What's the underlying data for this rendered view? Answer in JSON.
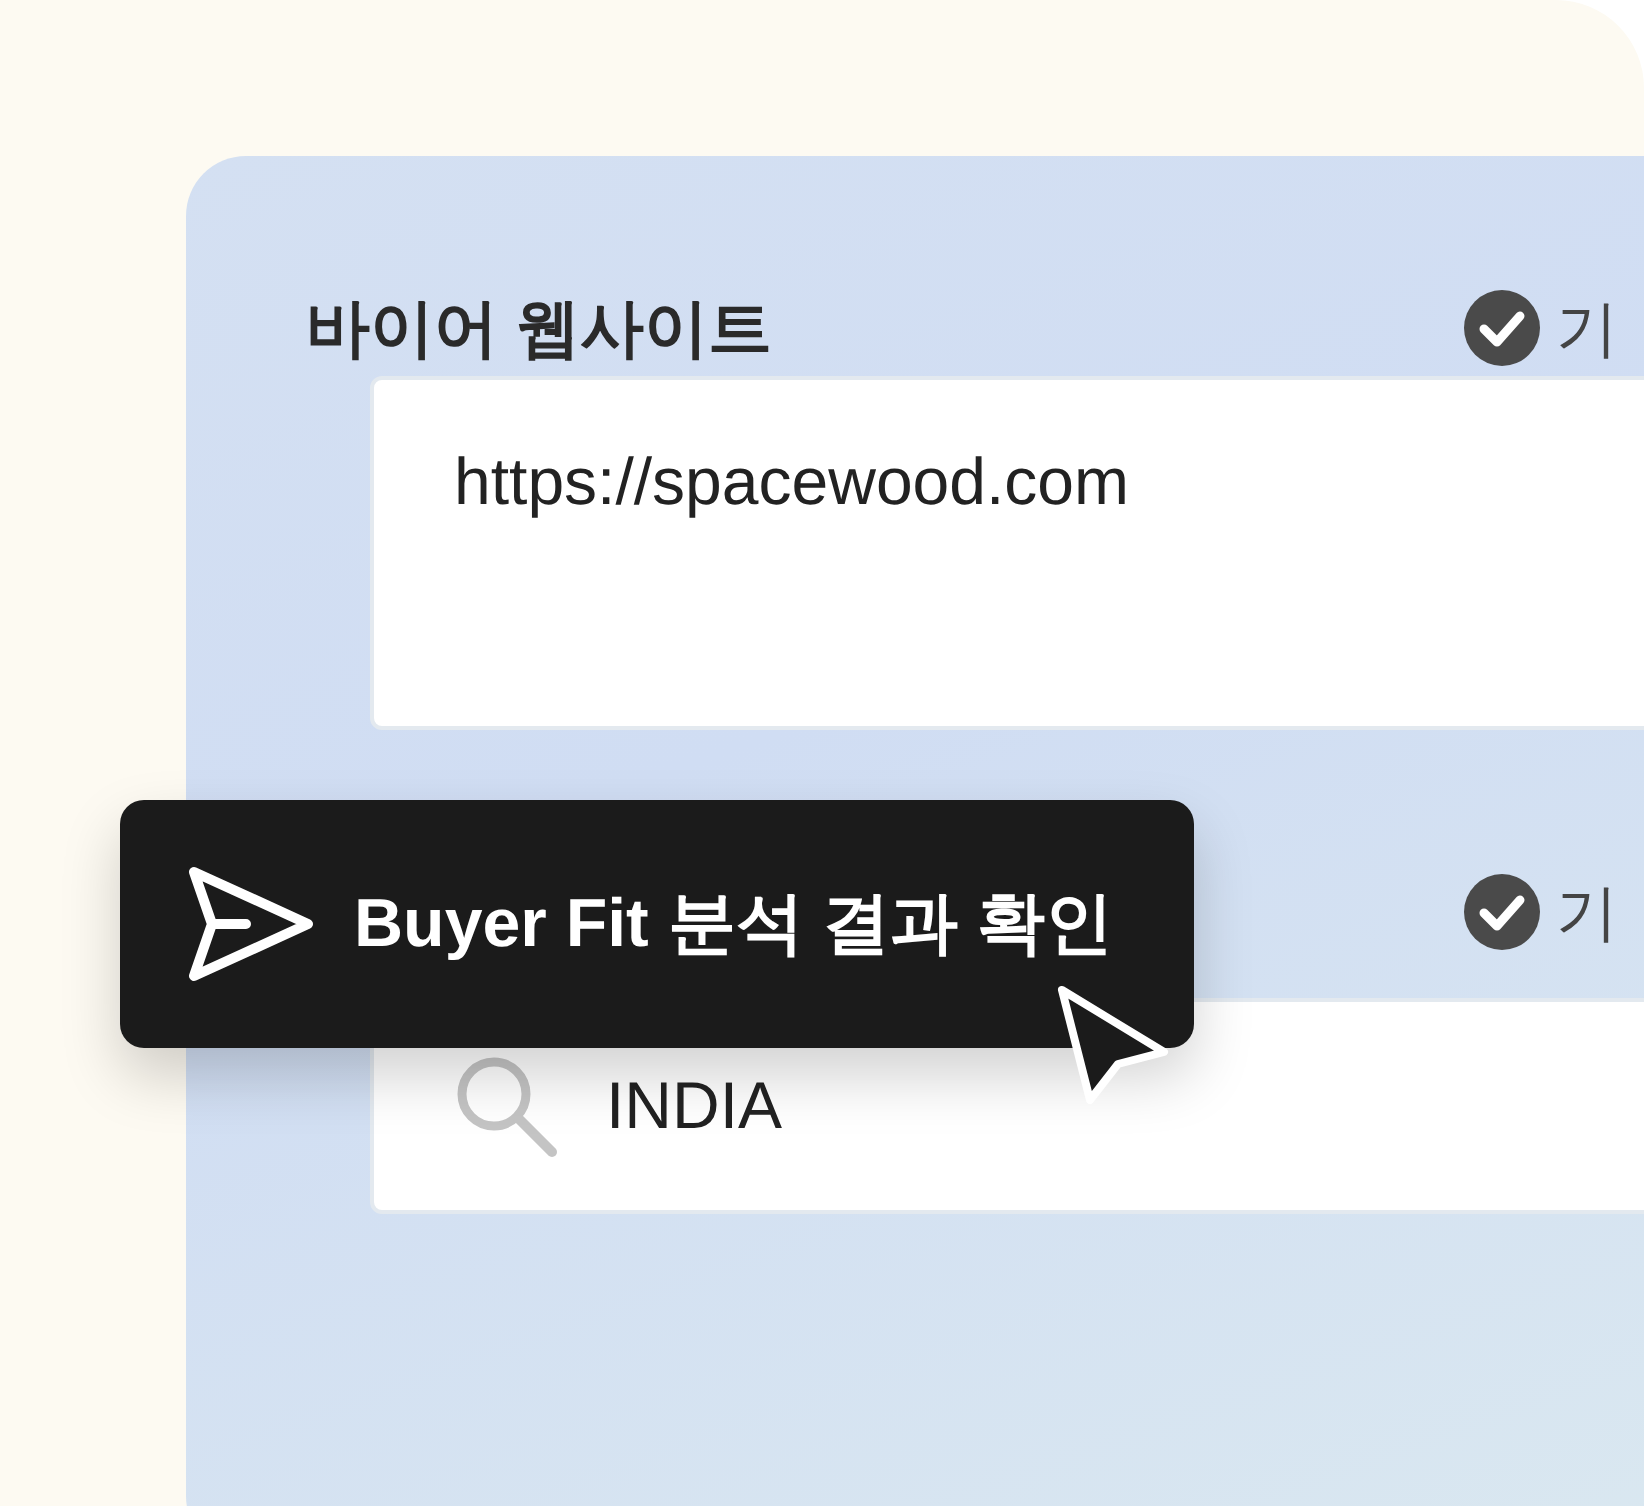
{
  "panel": {
    "sections": [
      {
        "title": "바이어 웹사이트",
        "badge": {
          "checked": true,
          "label": "기"
        },
        "field": {
          "kind": "text",
          "value": "https://spacewood.com"
        }
      },
      {
        "badge": {
          "checked": true,
          "label": "기"
        },
        "field": {
          "kind": "search",
          "value": "INDIA"
        }
      }
    ]
  },
  "action_button": {
    "label": "Buyer Fit 분석 결과 확인"
  }
}
